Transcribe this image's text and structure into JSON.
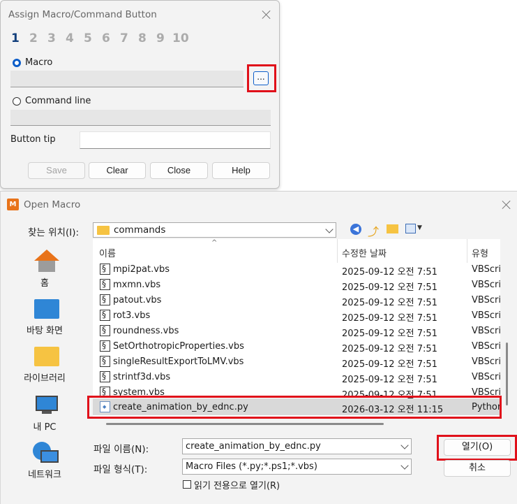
{
  "assign": {
    "title": "Assign Macro/Command Button",
    "numbers": [
      "1",
      "2",
      "3",
      "4",
      "5",
      "6",
      "7",
      "8",
      "9",
      "10"
    ],
    "macro_label": "Macro",
    "browse_label": "...",
    "command_line_label": "Command line",
    "button_tip_label": "Button tip",
    "button_tip_value": "",
    "save_label": "Save",
    "clear_label": "Clear",
    "close_label": "Close",
    "help_label": "Help"
  },
  "open": {
    "title": "Open Macro",
    "app_icon_text": "M",
    "look_in_label": "찾는 위치(I):",
    "look_in_value": "commands",
    "places": [
      "홈",
      "바탕 화면",
      "라이브러리",
      "내 PC",
      "네트워크"
    ],
    "columns": {
      "name": "이름",
      "date": "수정한 날짜",
      "type": "유형"
    },
    "files": [
      {
        "name": "mpi2pat.vbs",
        "date": "2025-09-12 오전 7:51",
        "type": "VBScri"
      },
      {
        "name": "mxmn.vbs",
        "date": "2025-09-12 오전 7:51",
        "type": "VBScri"
      },
      {
        "name": "patout.vbs",
        "date": "2025-09-12 오전 7:51",
        "type": "VBScri"
      },
      {
        "name": "rot3.vbs",
        "date": "2025-09-12 오전 7:51",
        "type": "VBScri"
      },
      {
        "name": "roundness.vbs",
        "date": "2025-09-12 오전 7:51",
        "type": "VBScri"
      },
      {
        "name": "SetOrthotropicProperties.vbs",
        "date": "2025-09-12 오전 7:51",
        "type": "VBScri"
      },
      {
        "name": "singleResultExportToLMV.vbs",
        "date": "2025-09-12 오전 7:51",
        "type": "VBScri"
      },
      {
        "name": "strintf3d.vbs",
        "date": "2025-09-12 오전 7:51",
        "type": "VBScri"
      },
      {
        "name": "system.vbs",
        "date": "2025-09-12 오전 7:51",
        "type": "VBScri"
      },
      {
        "name": "create_animation_by_ednc.py",
        "date": "2026-03-12 오전 11:15",
        "type": "Pythor"
      }
    ],
    "filename_label": "파일 이름(N):",
    "filename_value": "create_animation_by_ednc.py",
    "filetype_label": "파일 형식(T):",
    "filetype_value": "Macro Files (*.py;*.ps1;*.vbs)",
    "readonly_label": "읽기 전용으로 열기(R)",
    "open_button": "열기(O)",
    "cancel_button": "취소"
  },
  "colors": {
    "highlight_red": "#e0101a",
    "radio_blue": "#0d5ec9",
    "selection": "#d9d9d9"
  }
}
